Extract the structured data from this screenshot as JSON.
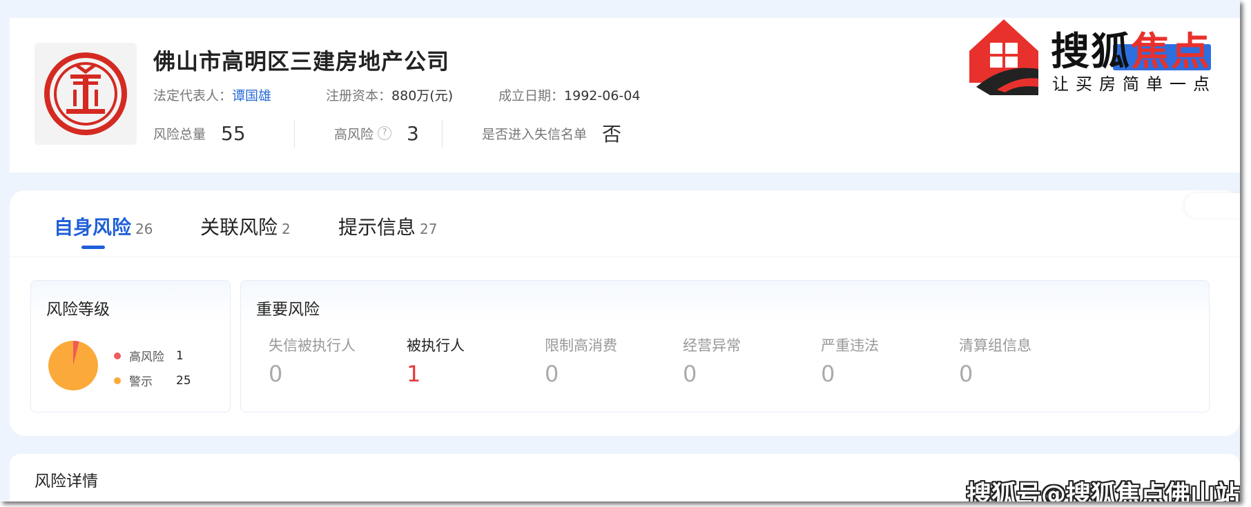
{
  "company": {
    "name": "佛山市高明区三建房地产公司",
    "legal_rep_label": "法定代表人：",
    "legal_rep_value": "谭国雄",
    "capital_label": "注册资本：",
    "capital_value": "880万(元)",
    "founded_label": "成立日期：",
    "founded_value": "1992-06-04"
  },
  "summary": {
    "total_label": "风险总量",
    "total_value": "55",
    "high_label": "高风险",
    "high_value": "3",
    "blacklist_label": "是否进入失信名单",
    "blacklist_value": "否",
    "help_glyph": "?"
  },
  "watermark": {
    "brand_black": "搜狐",
    "brand_red": "焦点",
    "slogan": "让买房简单一点",
    "footer": "搜狐号@搜狐焦点佛山站"
  },
  "tabs": [
    {
      "label": "自身风险",
      "count": "26",
      "active": true
    },
    {
      "label": "关联风险",
      "count": "2",
      "active": false
    },
    {
      "label": "提示信息",
      "count": "27",
      "active": false
    }
  ],
  "risk_level": {
    "title": "风险等级",
    "items": [
      {
        "label": "高风险",
        "count": "1",
        "color": "#ef5b5b"
      },
      {
        "label": "警示",
        "count": "25",
        "color": "#fba93a"
      }
    ]
  },
  "important": {
    "title": "重要风险",
    "items": [
      {
        "label": "失信被执行人",
        "value": "0"
      },
      {
        "label": "被执行人",
        "value": "1"
      },
      {
        "label": "限制高消费",
        "value": "0"
      },
      {
        "label": "经营异常",
        "value": "0"
      },
      {
        "label": "严重违法",
        "value": "0"
      },
      {
        "label": "清算组信息",
        "value": "0"
      }
    ]
  },
  "details": {
    "title": "风险详情"
  },
  "colors": {
    "accent": "#1f5fd8",
    "danger": "#e5393a",
    "warning": "#fba93a",
    "link": "#2b6cd9"
  }
}
